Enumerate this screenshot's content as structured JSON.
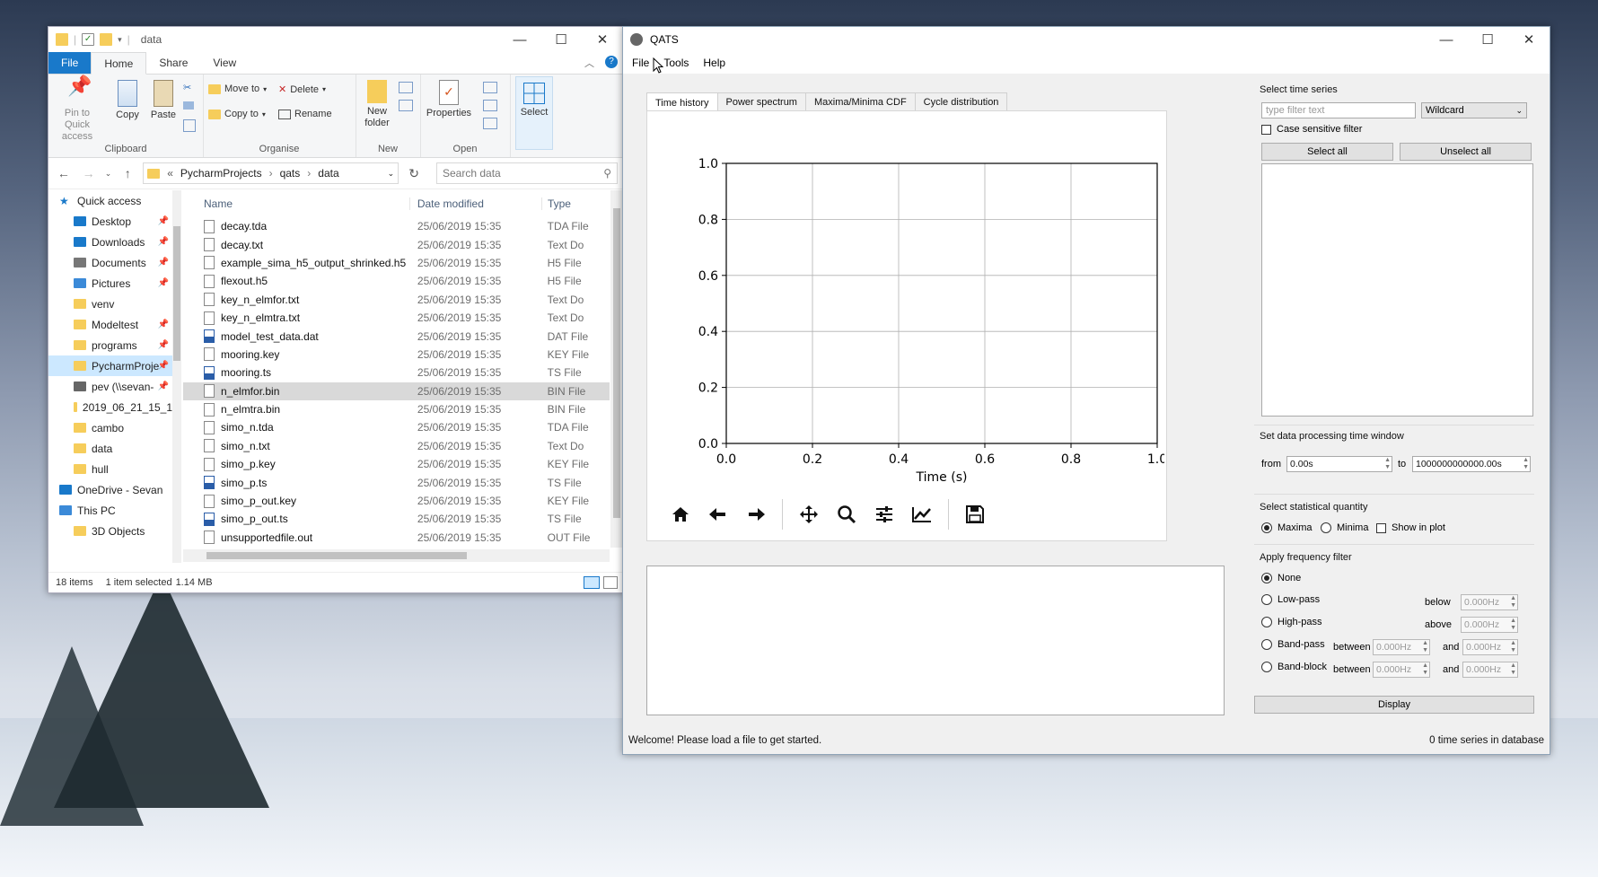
{
  "explorer": {
    "title": "data",
    "tabs": [
      "File",
      "Home",
      "Share",
      "View"
    ],
    "ribbon": {
      "clipboard": {
        "label": "Clipboard",
        "pin": "Pin to Quick access",
        "copy": "Copy",
        "paste": "Paste"
      },
      "organise": {
        "label": "Organise",
        "move_to": "Move to",
        "copy_to": "Copy to",
        "delete": "Delete",
        "rename": "Rename"
      },
      "new": {
        "label": "New",
        "new_folder": "New folder"
      },
      "open": {
        "label": "Open",
        "properties": "Properties"
      },
      "select": {
        "label": "Select"
      }
    },
    "breadcrumb": [
      "PycharmProjects",
      "qats",
      "data"
    ],
    "search_placeholder": "Search data",
    "columns": {
      "name": "Name",
      "date": "Date modified",
      "type": "Type"
    },
    "nav": [
      {
        "label": "Quick access",
        "icon": "star-icon"
      },
      {
        "label": "Desktop",
        "icon": "desktop-icon",
        "pinned": true
      },
      {
        "label": "Downloads",
        "icon": "download-icon",
        "pinned": true
      },
      {
        "label": "Documents",
        "icon": "documents-icon",
        "pinned": true
      },
      {
        "label": "Pictures",
        "icon": "pictures-icon",
        "pinned": true
      },
      {
        "label": "venv",
        "icon": "folder-icon"
      },
      {
        "label": "Modeltest",
        "icon": "folder-icon",
        "pinned": true
      },
      {
        "label": "programs",
        "icon": "folder-icon",
        "pinned": true
      },
      {
        "label": "PycharmProje",
        "icon": "folder-icon",
        "pinned": true,
        "selected": true
      },
      {
        "label": "pev (\\\\sevan-",
        "icon": "network-drive-icon",
        "pinned": true
      },
      {
        "label": "2019_06_21_15_1",
        "icon": "folder-icon"
      },
      {
        "label": "cambo",
        "icon": "folder-icon"
      },
      {
        "label": "data",
        "icon": "folder-icon"
      },
      {
        "label": "hull",
        "icon": "folder-icon"
      },
      {
        "label": "OneDrive - Sevan",
        "icon": "onedrive-icon"
      },
      {
        "label": "This PC",
        "icon": "pc-icon"
      },
      {
        "label": "3D Objects",
        "icon": "folder-icon"
      }
    ],
    "files": [
      {
        "name": "decay.tda",
        "date": "25/06/2019 15:35",
        "type": "TDA File"
      },
      {
        "name": "decay.txt",
        "date": "25/06/2019 15:35",
        "type": "Text Do"
      },
      {
        "name": "example_sima_h5_output_shrinked.h5",
        "date": "25/06/2019 15:35",
        "type": "H5 File"
      },
      {
        "name": "flexout.h5",
        "date": "25/06/2019 15:35",
        "type": "H5 File"
      },
      {
        "name": "key_n_elmfor.txt",
        "date": "25/06/2019 15:35",
        "type": "Text Do"
      },
      {
        "name": "key_n_elmtra.txt",
        "date": "25/06/2019 15:35",
        "type": "Text Do"
      },
      {
        "name": "model_test_data.dat",
        "date": "25/06/2019 15:35",
        "type": "DAT File"
      },
      {
        "name": "mooring.key",
        "date": "25/06/2019 15:35",
        "type": "KEY File"
      },
      {
        "name": "mooring.ts",
        "date": "25/06/2019 15:35",
        "type": "TS File"
      },
      {
        "name": "n_elmfor.bin",
        "date": "25/06/2019 15:35",
        "type": "BIN File",
        "selected": true
      },
      {
        "name": "n_elmtra.bin",
        "date": "25/06/2019 15:35",
        "type": "BIN File"
      },
      {
        "name": "simo_n.tda",
        "date": "25/06/2019 15:35",
        "type": "TDA File"
      },
      {
        "name": "simo_n.txt",
        "date": "25/06/2019 15:35",
        "type": "Text Do"
      },
      {
        "name": "simo_p.key",
        "date": "25/06/2019 15:35",
        "type": "KEY File"
      },
      {
        "name": "simo_p.ts",
        "date": "25/06/2019 15:35",
        "type": "TS File"
      },
      {
        "name": "simo_p_out.key",
        "date": "25/06/2019 15:35",
        "type": "KEY File"
      },
      {
        "name": "simo_p_out.ts",
        "date": "25/06/2019 15:35",
        "type": "TS File"
      },
      {
        "name": "unsupportedfile.out",
        "date": "25/06/2019 15:35",
        "type": "OUT File"
      }
    ],
    "status": {
      "items": "18 items",
      "selected": "1 item selected",
      "size": "1.14 MB"
    }
  },
  "qats": {
    "title": "QATS",
    "menu": [
      "File",
      "Tools",
      "Help"
    ],
    "tabs": [
      "Time history",
      "Power spectrum",
      "Maxima/Minima CDF",
      "Cycle distribution"
    ],
    "chart_data": {
      "type": "line",
      "series": [],
      "xlabel": "Time (s)",
      "ylabel": "",
      "xlim": [
        0.0,
        1.0
      ],
      "ylim": [
        0.0,
        1.0
      ],
      "xticks": [
        "0.0",
        "0.2",
        "0.4",
        "0.6",
        "0.8",
        "1.0"
      ],
      "yticks": [
        "0.0",
        "0.2",
        "0.4",
        "0.6",
        "0.8",
        "1.0"
      ],
      "grid": true
    },
    "toolbar_icons": [
      "home-icon",
      "back-icon",
      "forward-icon",
      "pan-icon",
      "zoom-icon",
      "configure-subplots-icon",
      "edit-axis-icon",
      "save-icon"
    ],
    "select": {
      "title": "Select time series",
      "filter_placeholder": "type filter text",
      "mode": "Wildcard",
      "case_sensitive": "Case sensitive filter",
      "select_all": "Select all",
      "unselect_all": "Unselect all"
    },
    "window": {
      "title": "Set data processing time window",
      "from_label": "from",
      "from": "0.00s",
      "to_label": "to",
      "to": "1000000000000.00s"
    },
    "stat": {
      "title": "Select statistical quantity",
      "maxima": "Maxima",
      "minima": "Minima",
      "show": "Show in plot"
    },
    "filter": {
      "title": "Apply frequency filter",
      "none": "None",
      "lowpass": "Low-pass",
      "below": "below",
      "highpass": "High-pass",
      "above": "above",
      "bandpass": "Band-pass",
      "bandblock": "Band-block",
      "between": "between",
      "and": "and",
      "zero": "0.000Hz"
    },
    "display": "Display",
    "status_left": "Welcome! Please load a file to get started.",
    "status_right": "0 time series in database"
  }
}
